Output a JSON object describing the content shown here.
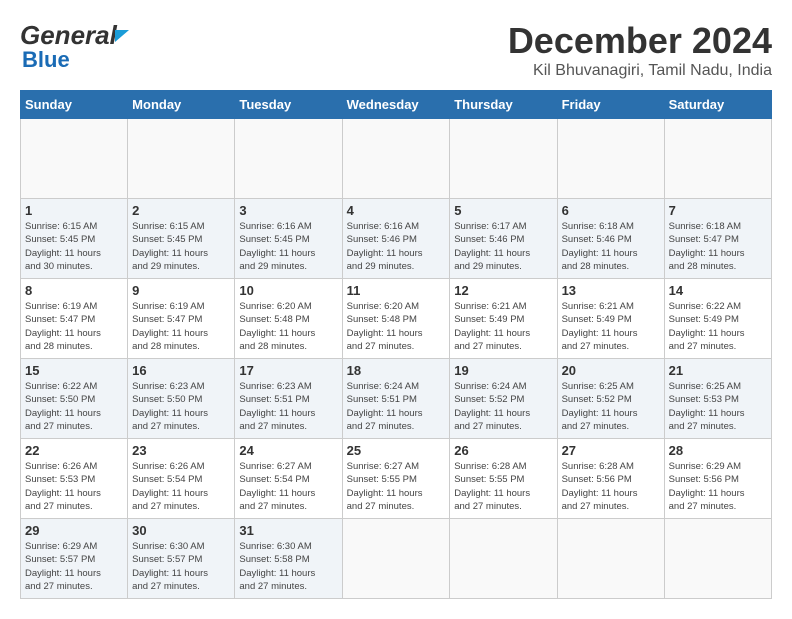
{
  "header": {
    "logo_general": "General",
    "logo_blue": "Blue",
    "title": "December 2024",
    "subtitle": "Kil Bhuvanagiri, Tamil Nadu, India"
  },
  "calendar": {
    "days_of_week": [
      "Sunday",
      "Monday",
      "Tuesday",
      "Wednesday",
      "Thursday",
      "Friday",
      "Saturday"
    ],
    "weeks": [
      [
        {
          "day": "",
          "detail": ""
        },
        {
          "day": "",
          "detail": ""
        },
        {
          "day": "",
          "detail": ""
        },
        {
          "day": "",
          "detail": ""
        },
        {
          "day": "",
          "detail": ""
        },
        {
          "day": "",
          "detail": ""
        },
        {
          "day": "",
          "detail": ""
        }
      ],
      [
        {
          "day": "1",
          "detail": "Sunrise: 6:15 AM\nSunset: 5:45 PM\nDaylight: 11 hours\nand 30 minutes."
        },
        {
          "day": "2",
          "detail": "Sunrise: 6:15 AM\nSunset: 5:45 PM\nDaylight: 11 hours\nand 29 minutes."
        },
        {
          "day": "3",
          "detail": "Sunrise: 6:16 AM\nSunset: 5:45 PM\nDaylight: 11 hours\nand 29 minutes."
        },
        {
          "day": "4",
          "detail": "Sunrise: 6:16 AM\nSunset: 5:46 PM\nDaylight: 11 hours\nand 29 minutes."
        },
        {
          "day": "5",
          "detail": "Sunrise: 6:17 AM\nSunset: 5:46 PM\nDaylight: 11 hours\nand 29 minutes."
        },
        {
          "day": "6",
          "detail": "Sunrise: 6:18 AM\nSunset: 5:46 PM\nDaylight: 11 hours\nand 28 minutes."
        },
        {
          "day": "7",
          "detail": "Sunrise: 6:18 AM\nSunset: 5:47 PM\nDaylight: 11 hours\nand 28 minutes."
        }
      ],
      [
        {
          "day": "8",
          "detail": "Sunrise: 6:19 AM\nSunset: 5:47 PM\nDaylight: 11 hours\nand 28 minutes."
        },
        {
          "day": "9",
          "detail": "Sunrise: 6:19 AM\nSunset: 5:47 PM\nDaylight: 11 hours\nand 28 minutes."
        },
        {
          "day": "10",
          "detail": "Sunrise: 6:20 AM\nSunset: 5:48 PM\nDaylight: 11 hours\nand 28 minutes."
        },
        {
          "day": "11",
          "detail": "Sunrise: 6:20 AM\nSunset: 5:48 PM\nDaylight: 11 hours\nand 27 minutes."
        },
        {
          "day": "12",
          "detail": "Sunrise: 6:21 AM\nSunset: 5:49 PM\nDaylight: 11 hours\nand 27 minutes."
        },
        {
          "day": "13",
          "detail": "Sunrise: 6:21 AM\nSunset: 5:49 PM\nDaylight: 11 hours\nand 27 minutes."
        },
        {
          "day": "14",
          "detail": "Sunrise: 6:22 AM\nSunset: 5:49 PM\nDaylight: 11 hours\nand 27 minutes."
        }
      ],
      [
        {
          "day": "15",
          "detail": "Sunrise: 6:22 AM\nSunset: 5:50 PM\nDaylight: 11 hours\nand 27 minutes."
        },
        {
          "day": "16",
          "detail": "Sunrise: 6:23 AM\nSunset: 5:50 PM\nDaylight: 11 hours\nand 27 minutes."
        },
        {
          "day": "17",
          "detail": "Sunrise: 6:23 AM\nSunset: 5:51 PM\nDaylight: 11 hours\nand 27 minutes."
        },
        {
          "day": "18",
          "detail": "Sunrise: 6:24 AM\nSunset: 5:51 PM\nDaylight: 11 hours\nand 27 minutes."
        },
        {
          "day": "19",
          "detail": "Sunrise: 6:24 AM\nSunset: 5:52 PM\nDaylight: 11 hours\nand 27 minutes."
        },
        {
          "day": "20",
          "detail": "Sunrise: 6:25 AM\nSunset: 5:52 PM\nDaylight: 11 hours\nand 27 minutes."
        },
        {
          "day": "21",
          "detail": "Sunrise: 6:25 AM\nSunset: 5:53 PM\nDaylight: 11 hours\nand 27 minutes."
        }
      ],
      [
        {
          "day": "22",
          "detail": "Sunrise: 6:26 AM\nSunset: 5:53 PM\nDaylight: 11 hours\nand 27 minutes."
        },
        {
          "day": "23",
          "detail": "Sunrise: 6:26 AM\nSunset: 5:54 PM\nDaylight: 11 hours\nand 27 minutes."
        },
        {
          "day": "24",
          "detail": "Sunrise: 6:27 AM\nSunset: 5:54 PM\nDaylight: 11 hours\nand 27 minutes."
        },
        {
          "day": "25",
          "detail": "Sunrise: 6:27 AM\nSunset: 5:55 PM\nDaylight: 11 hours\nand 27 minutes."
        },
        {
          "day": "26",
          "detail": "Sunrise: 6:28 AM\nSunset: 5:55 PM\nDaylight: 11 hours\nand 27 minutes."
        },
        {
          "day": "27",
          "detail": "Sunrise: 6:28 AM\nSunset: 5:56 PM\nDaylight: 11 hours\nand 27 minutes."
        },
        {
          "day": "28",
          "detail": "Sunrise: 6:29 AM\nSunset: 5:56 PM\nDaylight: 11 hours\nand 27 minutes."
        }
      ],
      [
        {
          "day": "29",
          "detail": "Sunrise: 6:29 AM\nSunset: 5:57 PM\nDaylight: 11 hours\nand 27 minutes."
        },
        {
          "day": "30",
          "detail": "Sunrise: 6:30 AM\nSunset: 5:57 PM\nDaylight: 11 hours\nand 27 minutes."
        },
        {
          "day": "31",
          "detail": "Sunrise: 6:30 AM\nSunset: 5:58 PM\nDaylight: 11 hours\nand 27 minutes."
        },
        {
          "day": "",
          "detail": ""
        },
        {
          "day": "",
          "detail": ""
        },
        {
          "day": "",
          "detail": ""
        },
        {
          "day": "",
          "detail": ""
        }
      ]
    ]
  }
}
